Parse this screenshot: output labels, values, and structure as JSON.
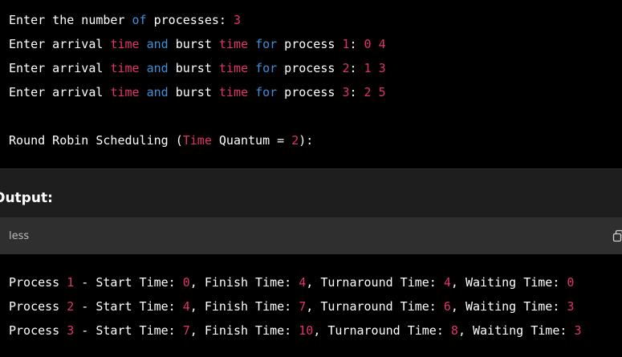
{
  "input_block": {
    "lines": [
      [
        {
          "t": "Enter the number ",
          "c": "plain"
        },
        {
          "t": "of",
          "c": "kb"
        },
        {
          "t": " processes: ",
          "c": "plain"
        },
        {
          "t": "3",
          "c": "num"
        }
      ],
      [
        {
          "t": "Enter arrival ",
          "c": "plain"
        },
        {
          "t": "time",
          "c": "kw"
        },
        {
          "t": " ",
          "c": "plain"
        },
        {
          "t": "and",
          "c": "kb"
        },
        {
          "t": " burst ",
          "c": "plain"
        },
        {
          "t": "time",
          "c": "kw"
        },
        {
          "t": " ",
          "c": "plain"
        },
        {
          "t": "for",
          "c": "kb"
        },
        {
          "t": " process ",
          "c": "plain"
        },
        {
          "t": "1",
          "c": "num"
        },
        {
          "t": ": ",
          "c": "plain"
        },
        {
          "t": "0",
          "c": "num"
        },
        {
          "t": " ",
          "c": "plain"
        },
        {
          "t": "4",
          "c": "num"
        }
      ],
      [
        {
          "t": "Enter arrival ",
          "c": "plain"
        },
        {
          "t": "time",
          "c": "kw"
        },
        {
          "t": " ",
          "c": "plain"
        },
        {
          "t": "and",
          "c": "kb"
        },
        {
          "t": " burst ",
          "c": "plain"
        },
        {
          "t": "time",
          "c": "kw"
        },
        {
          "t": " ",
          "c": "plain"
        },
        {
          "t": "for",
          "c": "kb"
        },
        {
          "t": " process ",
          "c": "plain"
        },
        {
          "t": "2",
          "c": "num"
        },
        {
          "t": ": ",
          "c": "plain"
        },
        {
          "t": "1",
          "c": "num"
        },
        {
          "t": " ",
          "c": "plain"
        },
        {
          "t": "3",
          "c": "num"
        }
      ],
      [
        {
          "t": "Enter arrival ",
          "c": "plain"
        },
        {
          "t": "time",
          "c": "kw"
        },
        {
          "t": " ",
          "c": "plain"
        },
        {
          "t": "and",
          "c": "kb"
        },
        {
          "t": " burst ",
          "c": "plain"
        },
        {
          "t": "time",
          "c": "kw"
        },
        {
          "t": " ",
          "c": "plain"
        },
        {
          "t": "for",
          "c": "kb"
        },
        {
          "t": " process ",
          "c": "plain"
        },
        {
          "t": "3",
          "c": "num"
        },
        {
          "t": ": ",
          "c": "plain"
        },
        {
          "t": "2",
          "c": "num"
        },
        {
          "t": " ",
          "c": "plain"
        },
        {
          "t": "5",
          "c": "num"
        }
      ],
      [],
      [
        {
          "t": "Round Robin Scheduling (",
          "c": "plain"
        },
        {
          "t": "Time",
          "c": "kw"
        },
        {
          "t": " Quantum = ",
          "c": "plain"
        },
        {
          "t": "2",
          "c": "num"
        },
        {
          "t": "):",
          "c": "plain"
        }
      ]
    ]
  },
  "output_heading": "Output:",
  "code_header": {
    "language": "less",
    "copy_icon": "copy-icon"
  },
  "output_block": {
    "lines": [
      [
        {
          "t": "Process ",
          "c": "plain"
        },
        {
          "t": "1",
          "c": "num"
        },
        {
          "t": " - Start Time: ",
          "c": "plain"
        },
        {
          "t": "0",
          "c": "num"
        },
        {
          "t": ", Finish Time: ",
          "c": "plain"
        },
        {
          "t": "4",
          "c": "num"
        },
        {
          "t": ", Turnaround Time: ",
          "c": "plain"
        },
        {
          "t": "4",
          "c": "num"
        },
        {
          "t": ", Waiting Time: ",
          "c": "plain"
        },
        {
          "t": "0",
          "c": "num"
        }
      ],
      [
        {
          "t": "Process ",
          "c": "plain"
        },
        {
          "t": "2",
          "c": "num"
        },
        {
          "t": " - Start Time: ",
          "c": "plain"
        },
        {
          "t": "4",
          "c": "num"
        },
        {
          "t": ", Finish Time: ",
          "c": "plain"
        },
        {
          "t": "7",
          "c": "num"
        },
        {
          "t": ", Turnaround Time: ",
          "c": "plain"
        },
        {
          "t": "6",
          "c": "num"
        },
        {
          "t": ", Waiting Time: ",
          "c": "plain"
        },
        {
          "t": "3",
          "c": "num"
        }
      ],
      [
        {
          "t": "Process ",
          "c": "plain"
        },
        {
          "t": "3",
          "c": "num"
        },
        {
          "t": " - Start Time: ",
          "c": "plain"
        },
        {
          "t": "7",
          "c": "num"
        },
        {
          "t": ", Finish Time: ",
          "c": "plain"
        },
        {
          "t": "10",
          "c": "num"
        },
        {
          "t": ", Turnaround Time: ",
          "c": "plain"
        },
        {
          "t": "8",
          "c": "num"
        },
        {
          "t": ", Waiting Time: ",
          "c": "plain"
        },
        {
          "t": "3",
          "c": "num"
        }
      ]
    ]
  },
  "colors": {
    "background": "#000000",
    "text": "#ffffff",
    "keyword_pink": "#e0336b",
    "keyword_blue": "#3d8fd8",
    "header_bar": "#2f2f2f",
    "output_band": "#1e1e1e"
  }
}
